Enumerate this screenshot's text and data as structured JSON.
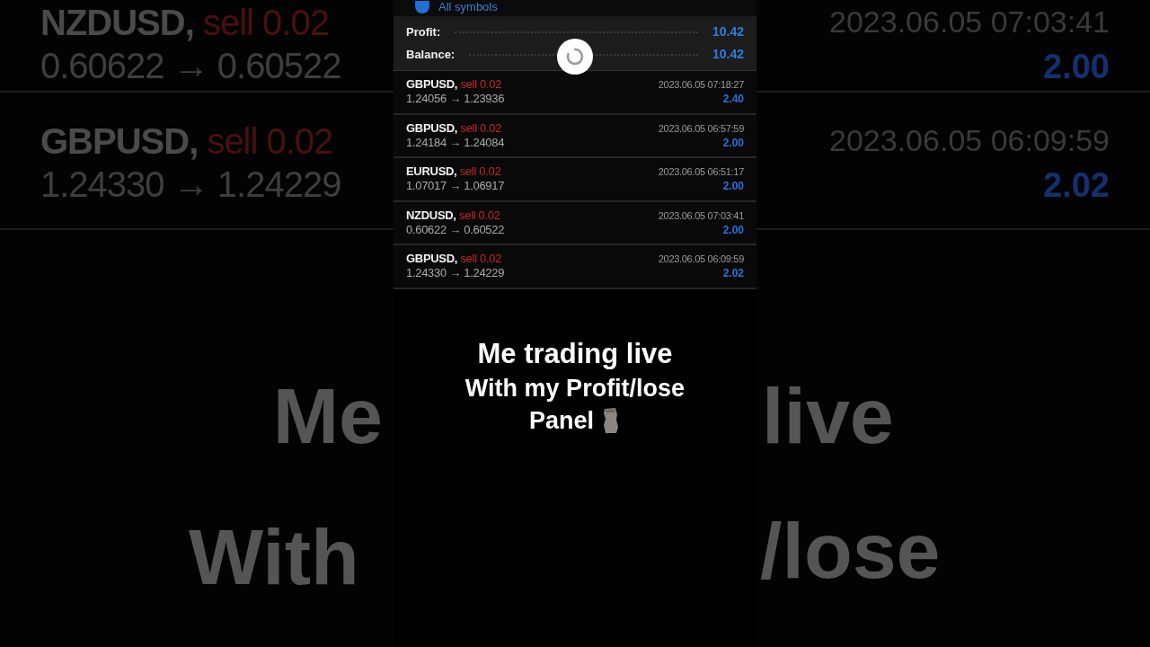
{
  "header": {
    "filter": "All symbols"
  },
  "summary": [
    {
      "label": "Profit:",
      "value": "10.42"
    },
    {
      "label": "Balance:",
      "value": "10.42"
    }
  ],
  "loading": true,
  "trades": [
    {
      "symbol": "GBPUSD,",
      "side": "sell 0.02",
      "prices": "1.24056 → 1.23936",
      "time": "2023.06.05 07:18:27",
      "profit": "2.40"
    },
    {
      "symbol": "GBPUSD,",
      "side": "sell 0.02",
      "prices": "1.24184 → 1.24084",
      "time": "2023.06.05 06:57:59",
      "profit": "2.00"
    },
    {
      "symbol": "EURUSD,",
      "side": "sell 0.02",
      "prices": "1.07017 → 1.06917",
      "time": "2023.06.05 06:51:17",
      "profit": "2.00"
    },
    {
      "symbol": "NZDUSD,",
      "side": "sell 0.02",
      "prices": "0.60622 → 0.60522",
      "time": "2023.06.05 07:03:41",
      "profit": "2.00"
    },
    {
      "symbol": "GBPUSD,",
      "side": "sell 0.02",
      "prices": "1.24330 → 1.24229",
      "time": "2023.06.05 06:09:59",
      "profit": "2.02"
    }
  ],
  "caption": [
    "Me trading live",
    "With my Profit/lose",
    "Panel"
  ],
  "background": {
    "rows": [
      {
        "symbol": "NZDUSD,",
        "side": "sell 0.02",
        "prices": "0.60622 → 0.60522",
        "time": "2023.06.05 07:03:41",
        "profit": "2.00"
      },
      {
        "symbol": "GBPUSD,",
        "side": "sell 0.02",
        "prices": "1.24330 → 1.24229",
        "time": "2023.06.05 06:09:59",
        "profit": "2.02"
      }
    ],
    "caption_left": [
      "Me",
      "With"
    ],
    "caption_right": [
      "live",
      "/lose"
    ]
  }
}
